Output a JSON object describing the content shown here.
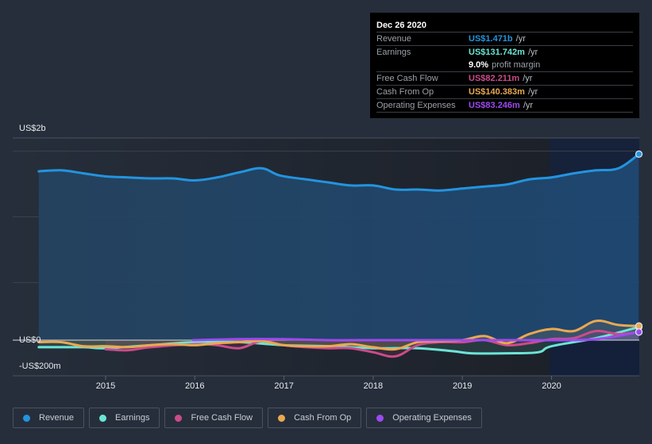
{
  "tooltip": {
    "date": "Dec 26 2020",
    "rows": [
      {
        "label": "Revenue",
        "value": "US$1.471b",
        "unit": "/yr",
        "color": "#2394df"
      },
      {
        "label": "Earnings",
        "value": "US$131.742m",
        "unit": "/yr",
        "color": "#6ce5d5"
      },
      {
        "label": "",
        "margin_value": "9.0%",
        "margin_label": "profit margin"
      },
      {
        "label": "Free Cash Flow",
        "value": "US$82.211m",
        "unit": "/yr",
        "color": "#cc4b8a"
      },
      {
        "label": "Cash From Op",
        "value": "US$140.383m",
        "unit": "/yr",
        "color": "#e9a951"
      },
      {
        "label": "Operating Expenses",
        "value": "US$83.246m",
        "unit": "/yr",
        "color": "#9d4af0"
      }
    ]
  },
  "chart_data": {
    "type": "line",
    "title": "",
    "xlabel": "",
    "ylabel": "",
    "y_unit": "US$ billions",
    "ylim": [
      -0.35,
      2.0
    ],
    "xlim": [
      2013.9,
      2021.0
    ],
    "y_tick_labels": [
      {
        "value": 2.0,
        "label": "US$2b"
      },
      {
        "value": 0.0,
        "label": "US$0"
      },
      {
        "value": -0.2,
        "label": "-US$200m"
      }
    ],
    "y_gridlines": [
      1.87,
      1.22,
      0.57
    ],
    "x_ticks": [
      {
        "value": 2015,
        "label": "2015"
      },
      {
        "value": 2016,
        "label": "2016"
      },
      {
        "value": 2017,
        "label": "2017"
      },
      {
        "value": 2018,
        "label": "2018"
      },
      {
        "value": 2019,
        "label": "2019"
      },
      {
        "value": 2020,
        "label": "2020"
      }
    ],
    "highlight_start": 2019.98,
    "legend_position": "bottom",
    "series": [
      {
        "name": "Revenue",
        "color": "#2394df",
        "area": true,
        "x": [
          2014.25,
          2014.5,
          2014.75,
          2015.0,
          2015.25,
          2015.5,
          2015.75,
          2016.0,
          2016.25,
          2016.5,
          2016.75,
          2016.95,
          2017.25,
          2017.5,
          2017.75,
          2018.0,
          2018.25,
          2018.5,
          2018.75,
          2019.0,
          2019.25,
          2019.5,
          2019.75,
          2020.0,
          2020.25,
          2020.5,
          2020.75,
          2020.98
        ],
        "values": [
          1.67,
          1.68,
          1.65,
          1.62,
          1.61,
          1.6,
          1.6,
          1.58,
          1.61,
          1.66,
          1.7,
          1.63,
          1.59,
          1.56,
          1.53,
          1.53,
          1.49,
          1.49,
          1.48,
          1.5,
          1.52,
          1.54,
          1.59,
          1.61,
          1.65,
          1.68,
          1.7,
          1.84
        ]
      },
      {
        "name": "Earnings",
        "color": "#6ce5d5",
        "area": false,
        "x": [
          2014.25,
          2014.75,
          2015.0,
          2015.5,
          2016.0,
          2016.5,
          2017.0,
          2017.5,
          2018.0,
          2018.5,
          2018.9,
          2019.1,
          2019.5,
          2019.85,
          2020.0,
          2020.5,
          2020.98
        ],
        "values": [
          -0.07,
          -0.07,
          -0.08,
          -0.05,
          -0.02,
          -0.02,
          -0.05,
          -0.06,
          -0.08,
          -0.08,
          -0.11,
          -0.13,
          -0.13,
          -0.12,
          -0.06,
          0.02,
          0.13
        ]
      },
      {
        "name": "Free Cash Flow",
        "color": "#cc4b8a",
        "area": false,
        "x": [
          2015.0,
          2015.25,
          2015.5,
          2016.0,
          2016.25,
          2016.5,
          2016.75,
          2017.0,
          2017.25,
          2017.5,
          2017.75,
          2018.0,
          2018.25,
          2018.5,
          2018.75,
          2019.0,
          2019.25,
          2019.5,
          2019.75,
          2020.0,
          2020.25,
          2020.5,
          2020.75,
          2020.98
        ],
        "values": [
          -0.09,
          -0.1,
          -0.07,
          -0.04,
          -0.05,
          -0.08,
          -0.01,
          -0.05,
          -0.07,
          -0.08,
          -0.08,
          -0.12,
          -0.16,
          -0.05,
          -0.02,
          -0.02,
          0.0,
          -0.05,
          -0.03,
          0.01,
          0.02,
          0.09,
          0.06,
          0.08
        ]
      },
      {
        "name": "Cash From Op",
        "color": "#e9a951",
        "area": false,
        "x": [
          2014.25,
          2014.5,
          2014.75,
          2015.0,
          2015.25,
          2015.5,
          2015.75,
          2016.0,
          2016.25,
          2016.5,
          2016.75,
          2017.0,
          2017.25,
          2017.5,
          2017.75,
          2018.0,
          2018.25,
          2018.5,
          2018.75,
          2019.0,
          2019.25,
          2019.5,
          2019.75,
          2020.0,
          2020.25,
          2020.5,
          2020.75,
          2020.98
        ],
        "values": [
          -0.02,
          -0.02,
          -0.06,
          -0.06,
          -0.07,
          -0.05,
          -0.04,
          -0.05,
          -0.03,
          -0.02,
          -0.01,
          -0.05,
          -0.06,
          -0.06,
          -0.04,
          -0.07,
          -0.09,
          -0.02,
          -0.01,
          0.0,
          0.04,
          -0.03,
          0.06,
          0.11,
          0.09,
          0.19,
          0.15,
          0.14
        ]
      },
      {
        "name": "Operating Expenses",
        "color": "#9d4af0",
        "area": false,
        "x": [
          2015.98,
          2016.5,
          2017.0,
          2017.5,
          2018.0,
          2018.5,
          2019.0,
          2019.5,
          2020.0,
          2020.5,
          2020.98
        ],
        "values": [
          0.0,
          0.01,
          0.01,
          0.0,
          0.0,
          0.0,
          0.0,
          0.0,
          0.0,
          0.01,
          0.08
        ]
      }
    ]
  },
  "legend": [
    {
      "label": "Revenue",
      "color": "#2394df"
    },
    {
      "label": "Earnings",
      "color": "#6ce5d5"
    },
    {
      "label": "Free Cash Flow",
      "color": "#cc4b8a"
    },
    {
      "label": "Cash From Op",
      "color": "#e9a951"
    },
    {
      "label": "Operating Expenses",
      "color": "#9d4af0"
    }
  ]
}
